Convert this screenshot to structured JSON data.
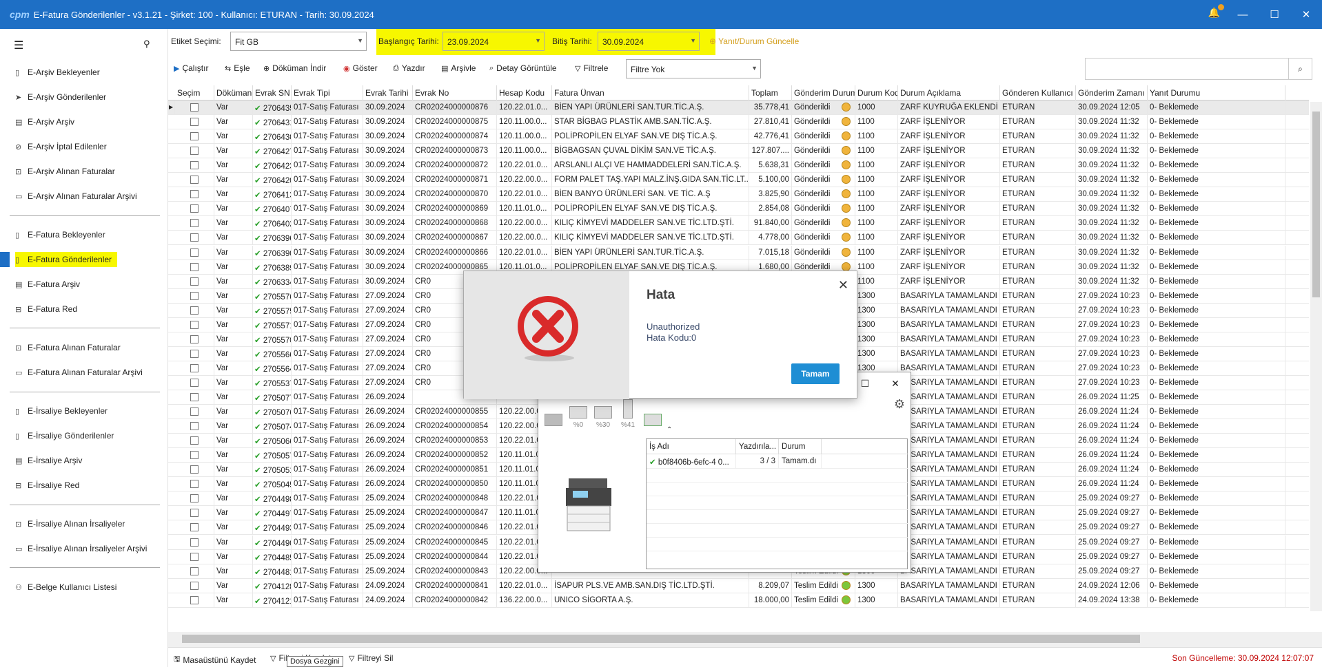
{
  "window": {
    "logo": "cpm",
    "title": "E-Fatura Gönderilenler - v3.1.21 - Şirket: 100 - Kullanıcı: ETURAN - Tarih: 30.09.2024",
    "min": "—",
    "max": "☐",
    "close": "✕",
    "notify_icon": "bell-icon"
  },
  "sidebar": {
    "items": [
      {
        "label": "E-Arşiv Bekleyenler",
        "icon": "document-icon"
      },
      {
        "label": "E-Arşiv Gönderilenler",
        "icon": "send-icon"
      },
      {
        "label": "E-Arşiv Arşiv",
        "icon": "archive-icon"
      },
      {
        "label": "E-Arşiv İptal Edilenler",
        "icon": "cancel-doc-icon"
      },
      {
        "label": "E-Arşiv Alınan Faturalar",
        "icon": "inbox-icon"
      },
      {
        "label": "E-Arşiv Alınan Faturalar Arşivi",
        "icon": "folder-icon"
      },
      {
        "label": "E-Fatura Bekleyenler",
        "icon": "document-icon"
      },
      {
        "label": "E-Fatura Gönderilenler",
        "icon": "document-icon"
      },
      {
        "label": "E-Fatura Arşiv",
        "icon": "archive-icon"
      },
      {
        "label": "E-Fatura Red",
        "icon": "reject-icon"
      },
      {
        "label": "E-Fatura Alınan Faturalar",
        "icon": "inbox-icon"
      },
      {
        "label": "E-Fatura Alınan Faturalar Arşivi",
        "icon": "folder-icon"
      },
      {
        "label": "E-İrsaliye Bekleyenler",
        "icon": "document-icon"
      },
      {
        "label": "E-İrsaliye Gönderilenler",
        "icon": "document-icon"
      },
      {
        "label": "E-İrsaliye Arşiv",
        "icon": "archive-icon"
      },
      {
        "label": "E-İrsaliye Red",
        "icon": "reject-icon"
      },
      {
        "label": "E-İrsaliye Alınan İrsaliyeler",
        "icon": "inbox-icon"
      },
      {
        "label": "E-İrsaliye Alınan İrsaliyeler Arşivi",
        "icon": "folder-icon"
      },
      {
        "label": "E-Belge Kullanıcı Listesi",
        "icon": "users-icon"
      }
    ]
  },
  "filters": {
    "etiket_label": "Etiket Seçimi:",
    "etiket_value": "Fit GB",
    "start_label": "Başlangıç Tarihi:",
    "start_value": "23.09.2024",
    "end_label": "Bitiş Tarihi:",
    "end_value": "30.09.2024",
    "refresh_label": "Yanıt/Durum Güncelle"
  },
  "toolbar": {
    "calistir": "Çalıştır",
    "esle": "Eşle",
    "dokuman_indir": "Döküman İndir",
    "goster": "Göster",
    "yazdir": "Yazdır",
    "arsivle": "Arşivle",
    "detay": "Detay Görüntüle",
    "filtrele": "Filtrele",
    "filtre_value": "Filtre Yok",
    "search_placeholder": ""
  },
  "grid": {
    "columns": [
      "Seçim",
      "Döküman",
      "Evrak SN",
      "Evrak Tipi",
      "Evrak Tarihi",
      "Evrak No",
      "Hesap Kodu",
      "Fatura Ünvan",
      "Toplam",
      "Gönderim Durumu",
      "Durum Kodu",
      "Durum Açıklama",
      "Gönderen Kullanıcı",
      "Gönderim Zamanı",
      "Yanıt Durumu"
    ],
    "rows": [
      [
        "Var",
        "2706435",
        "017-Satış Faturası",
        "30.09.2024",
        "CR02024000000876",
        "120.22.01.0...",
        "BİEN YAPI ÜRÜNLERİ SAN.TUR.TİC.A.Ş.",
        "35.778,41",
        "Gönderildi",
        "1000",
        "ZARF KUYRUĞA EKLENDİ",
        "ETURAN",
        "30.09.2024 12:05",
        "0- Beklemede"
      ],
      [
        "Var",
        "2706431",
        "017-Satış Faturası",
        "30.09.2024",
        "CR02024000000875",
        "120.11.00.0...",
        "STAR BİGBAG PLASTİK AMB.SAN.TİC.A.Ş.",
        "27.810,41",
        "Gönderildi",
        "1100",
        "ZARF İŞLENİYOR",
        "ETURAN",
        "30.09.2024 11:32",
        "0- Beklemede"
      ],
      [
        "Var",
        "2706430",
        "017-Satış Faturası",
        "30.09.2024",
        "CR02024000000874",
        "120.11.00.0...",
        "POLİPROPİLEN ELYAF SAN.VE DIŞ TİC.A.Ş.",
        "42.776,41",
        "Gönderildi",
        "1100",
        "ZARF İŞLENİYOR",
        "ETURAN",
        "30.09.2024 11:32",
        "0- Beklemede"
      ],
      [
        "Var",
        "2706427",
        "017-Satış Faturası",
        "30.09.2024",
        "CR02024000000873",
        "120.11.00.0...",
        "BİGBAGSAN ÇUVAL DİKİM SAN.VE TİC.A.Ş.",
        "127.807....",
        "Gönderildi",
        "1100",
        "ZARF İŞLENİYOR",
        "ETURAN",
        "30.09.2024 11:32",
        "0- Beklemede"
      ],
      [
        "Var",
        "2706423",
        "017-Satış Faturası",
        "30.09.2024",
        "CR02024000000872",
        "120.22.01.0...",
        "ARSLANLI ALÇI VE HAMMADDELERİ SAN.TİC.A.Ş.",
        "5.638,31",
        "Gönderildi",
        "1100",
        "ZARF İŞLENİYOR",
        "ETURAN",
        "30.09.2024 11:32",
        "0- Beklemede"
      ],
      [
        "Var",
        "2706420",
        "017-Satış Faturası",
        "30.09.2024",
        "CR02024000000871",
        "120.22.00.0...",
        "FORM PALET TAŞ.YAPI MALZ.İNŞ.GIDA SAN.TİC.LT...",
        "5.100,00",
        "Gönderildi",
        "1100",
        "ZARF İŞLENİYOR",
        "ETURAN",
        "30.09.2024 11:32",
        "0- Beklemede"
      ],
      [
        "Var",
        "2706413",
        "017-Satış Faturası",
        "30.09.2024",
        "CR02024000000870",
        "120.22.01.0...",
        "BİEN BANYO ÜRÜNLERİ SAN. VE TİC. A.Ş",
        "3.825,90",
        "Gönderildi",
        "1100",
        "ZARF İŞLENİYOR",
        "ETURAN",
        "30.09.2024 11:32",
        "0- Beklemede"
      ],
      [
        "Var",
        "2706407",
        "017-Satış Faturası",
        "30.09.2024",
        "CR02024000000869",
        "120.11.01.0...",
        "POLİPROPİLEN ELYAF SAN.VE DIŞ TİC.A.Ş.",
        "2.854,08",
        "Gönderildi",
        "1100",
        "ZARF İŞLENİYOR",
        "ETURAN",
        "30.09.2024 11:32",
        "0- Beklemede"
      ],
      [
        "Var",
        "2706402",
        "017-Satış Faturası",
        "30.09.2024",
        "CR02024000000868",
        "120.22.00.0...",
        "KILIÇ KİMYEVİ MADDELER SAN.VE TİC.LTD.ŞTİ.",
        "91.840,00",
        "Gönderildi",
        "1100",
        "ZARF İŞLENİYOR",
        "ETURAN",
        "30.09.2024 11:32",
        "0- Beklemede"
      ],
      [
        "Var",
        "2706396",
        "017-Satış Faturası",
        "30.09.2024",
        "CR02024000000867",
        "120.22.00.0...",
        "KILIÇ KİMYEVİ MADDELER SAN.VE TİC.LTD.ŞTİ.",
        "4.778,00",
        "Gönderildi",
        "1100",
        "ZARF İŞLENİYOR",
        "ETURAN",
        "30.09.2024 11:32",
        "0- Beklemede"
      ],
      [
        "Var",
        "2706390",
        "017-Satış Faturası",
        "30.09.2024",
        "CR02024000000866",
        "120.22.01.0...",
        "BİEN YAPI ÜRÜNLERİ SAN.TUR.TİC.A.Ş.",
        "7.015,18",
        "Gönderildi",
        "1100",
        "ZARF İŞLENİYOR",
        "ETURAN",
        "30.09.2024 11:32",
        "0- Beklemede"
      ],
      [
        "Var",
        "2706389",
        "017-Satış Faturası",
        "30.09.2024",
        "CR02024000000865",
        "120.11.01.0...",
        "POLİPROPİLEN ELYAF SAN.VE DIŞ TİC.A.Ş.",
        "1.680,00",
        "Gönderildi",
        "1100",
        "ZARF İŞLENİYOR",
        "ETURAN",
        "30.09.2024 11:32",
        "0- Beklemede"
      ],
      [
        "Var",
        "2706334",
        "017-Satış Faturası",
        "30.09.2024",
        "CR0",
        "",
        "",
        "",
        "",
        "1100",
        "ZARF İŞLENİYOR",
        "ETURAN",
        "30.09.2024 11:32",
        "0- Beklemede"
      ],
      [
        "Var",
        "2705576",
        "017-Satış Faturası",
        "27.09.2024",
        "CR0",
        "",
        "",
        "",
        "",
        "1300",
        "BASARIYLA TAMAMLANDI",
        "ETURAN",
        "27.09.2024 10:23",
        "0- Beklemede"
      ],
      [
        "Var",
        "2705575",
        "017-Satış Faturası",
        "27.09.2024",
        "CR0",
        "",
        "",
        "",
        "",
        "1300",
        "BASARIYLA TAMAMLANDI",
        "ETURAN",
        "27.09.2024 10:23",
        "0- Beklemede"
      ],
      [
        "Var",
        "2705571",
        "017-Satış Faturası",
        "27.09.2024",
        "CR0",
        "",
        "",
        "",
        "",
        "1300",
        "BASARIYLA TAMAMLANDI",
        "ETURAN",
        "27.09.2024 10:23",
        "0- Beklemede"
      ],
      [
        "Var",
        "2705570",
        "017-Satış Faturası",
        "27.09.2024",
        "CR0",
        "",
        "",
        "",
        "",
        "1300",
        "BASARIYLA TAMAMLANDI",
        "ETURAN",
        "27.09.2024 10:23",
        "0- Beklemede"
      ],
      [
        "Var",
        "2705566",
        "017-Satış Faturası",
        "27.09.2024",
        "CR0",
        "",
        "",
        "",
        "",
        "1300",
        "BASARIYLA TAMAMLANDI",
        "ETURAN",
        "27.09.2024 10:23",
        "0- Beklemede"
      ],
      [
        "Var",
        "2705564",
        "017-Satış Faturası",
        "27.09.2024",
        "CR0",
        "",
        "",
        "",
        "",
        "1300",
        "BASARIYLA TAMAMLANDI",
        "ETURAN",
        "27.09.2024 10:23",
        "0- Beklemede"
      ],
      [
        "Var",
        "2705537",
        "017-Satış Faturası",
        "27.09.2024",
        "CR0",
        "",
        "",
        "",
        "",
        "",
        "BASARIYLA TAMAMLANDI",
        "ETURAN",
        "27.09.2024 10:23",
        "0- Beklemede"
      ],
      [
        "Var",
        "2705077",
        "017-Satış Faturası",
        "26.09.2024",
        "",
        "",
        "",
        "",
        "",
        "",
        "BASARIYLA TAMAMLANDI",
        "ETURAN",
        "26.09.2024 11:25",
        "0- Beklemede"
      ],
      [
        "Var",
        "2705076",
        "017-Satış Faturası",
        "26.09.2024",
        "CR02024000000855",
        "120.22.00.0...",
        "",
        "",
        "",
        "",
        "BASARIYLA TAMAMLANDI",
        "ETURAN",
        "26.09.2024 11:24",
        "0- Beklemede"
      ],
      [
        "Var",
        "2705074",
        "017-Satış Faturası",
        "26.09.2024",
        "CR02024000000854",
        "120.22.00.0...",
        "",
        "",
        "",
        "",
        "BASARIYLA TAMAMLANDI",
        "ETURAN",
        "26.09.2024 11:24",
        "0- Beklemede"
      ],
      [
        "Var",
        "2705066",
        "017-Satış Faturası",
        "26.09.2024",
        "CR02024000000853",
        "120.22.01.0...",
        "",
        "",
        "",
        "",
        "BASARIYLA TAMAMLANDI",
        "ETURAN",
        "26.09.2024 11:24",
        "0- Beklemede"
      ],
      [
        "Var",
        "2705057",
        "017-Satış Faturası",
        "26.09.2024",
        "CR02024000000852",
        "120.11.01.0...",
        "",
        "",
        "",
        "",
        "BASARIYLA TAMAMLANDI",
        "ETURAN",
        "26.09.2024 11:24",
        "0- Beklemede"
      ],
      [
        "Var",
        "2705051",
        "017-Satış Faturası",
        "26.09.2024",
        "CR02024000000851",
        "120.11.01.0...",
        "",
        "",
        "",
        "",
        "BASARIYLA TAMAMLANDI",
        "ETURAN",
        "26.09.2024 11:24",
        "0- Beklemede"
      ],
      [
        "Var",
        "2705045",
        "017-Satış Faturası",
        "26.09.2024",
        "CR02024000000850",
        "120.11.01.0...",
        "",
        "",
        "",
        "",
        "BASARIYLA TAMAMLANDI",
        "ETURAN",
        "26.09.2024 11:24",
        "0- Beklemede"
      ],
      [
        "Var",
        "2704498",
        "017-Satış Faturası",
        "25.09.2024",
        "CR02024000000848",
        "120.22.01.0...",
        "",
        "",
        "",
        "",
        "BASARIYLA TAMAMLANDI",
        "ETURAN",
        "25.09.2024 09:27",
        "0- Beklemede"
      ],
      [
        "Var",
        "2704497",
        "017-Satış Faturası",
        "25.09.2024",
        "CR02024000000847",
        "120.11.01.0...",
        "",
        "",
        "",
        "",
        "BASARIYLA TAMAMLANDI",
        "ETURAN",
        "25.09.2024 09:27",
        "0- Beklemede"
      ],
      [
        "Var",
        "2704493",
        "017-Satış Faturası",
        "25.09.2024",
        "CR02024000000846",
        "120.22.01.0...",
        "",
        "",
        "",
        "",
        "BASARIYLA TAMAMLANDI",
        "ETURAN",
        "25.09.2024 09:27",
        "0- Beklemede"
      ],
      [
        "Var",
        "2704490",
        "017-Satış Faturası",
        "25.09.2024",
        "CR02024000000845",
        "120.22.01.0...",
        "",
        "",
        "",
        "",
        "BASARIYLA TAMAMLANDI",
        "ETURAN",
        "25.09.2024 09:27",
        "0- Beklemede"
      ],
      [
        "Var",
        "2704485",
        "017-Satış Faturası",
        "25.09.2024",
        "CR02024000000844",
        "120.22.01.0...",
        "",
        "",
        "",
        "",
        "BASARIYLA TAMAMLANDI",
        "ETURAN",
        "25.09.2024 09:27",
        "0- Beklemede"
      ],
      [
        "Var",
        "2704481",
        "017-Satış Faturası",
        "25.09.2024",
        "CR02024000000843",
        "120.22.00.0...",
        "",
        "",
        "Teslim Edildi",
        "1300",
        "BASARIYLA TAMAMLANDI",
        "ETURAN",
        "25.09.2024 09:27",
        "0- Beklemede"
      ],
      [
        "Var",
        "2704128",
        "017-Satış Faturası",
        "24.09.2024",
        "CR02024000000841",
        "120.22.01.0...",
        "İSAPUR PLS.VE AMB.SAN.DIŞ TİC.LTD.ŞTİ.",
        "8.209,07",
        "Teslim Edildi",
        "1300",
        "BASARIYLA TAMAMLANDI",
        "ETURAN",
        "24.09.2024 12:06",
        "0- Beklemede"
      ],
      [
        "Var",
        "2704121",
        "017-Satış Faturası",
        "24.09.2024",
        "CR02024000000842",
        "136.22.00.0...",
        "UNICO SİGORTA A.Ş.",
        "18.000,00",
        "Teslim Edildi",
        "1300",
        "BASARIYLA TAMAMLANDI",
        "ETURAN",
        "24.09.2024 13:38",
        "0- Beklemede"
      ]
    ]
  },
  "statusbar": {
    "save_desktop": "Masaüstünü Kaydet",
    "save_filter": "Filtreyi Kaydet",
    "clear_filter": "Filtreyi Sil",
    "tooltip": "Dosya Gezgini",
    "last_update": "Son Güncelleme: 30.09.2024 12:07:07"
  },
  "printer": {
    "tray_levels": [
      "%0",
      "%30",
      "%41"
    ],
    "columns": [
      "İş Adı",
      "Yazdırıla...",
      "Durum"
    ],
    "job": {
      "name": "b0f8406b-6efc-4 0...",
      "progress": "3 / 3",
      "status": "Tamam.dı"
    }
  },
  "dialog": {
    "title": "Hata",
    "message": "Unauthorized",
    "code": "Hata Kodu:0",
    "ok": "Tamam"
  },
  "colors": {
    "titlebar": "#1e6fc5",
    "highlight": "#f7f700",
    "ok_button": "#1f8ed4",
    "status_sent": "#f0b43c",
    "status_done": "#7cc63a",
    "last_update": "#c00000"
  }
}
